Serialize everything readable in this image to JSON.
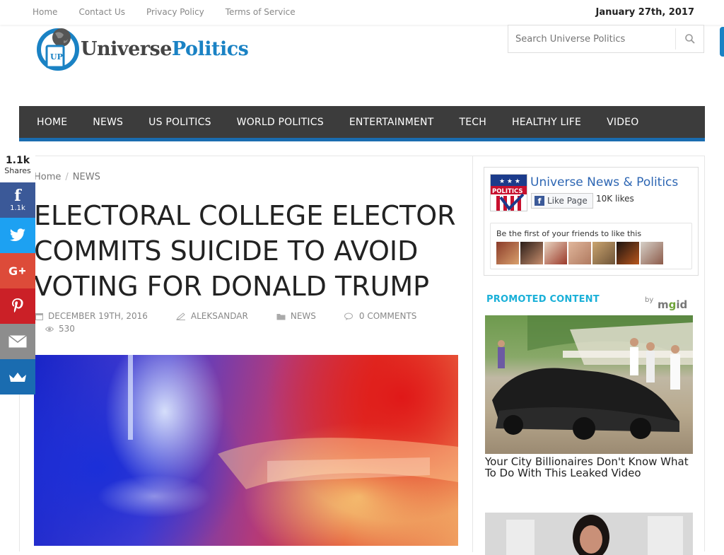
{
  "topbar": {
    "links": [
      "Home",
      "Contact Us",
      "Privacy Policy",
      "Terms of Service"
    ],
    "date": "January 27th, 2017"
  },
  "logo": {
    "mark_text": "UP",
    "name_part1": "Universe",
    "name_part2": "Politics"
  },
  "search": {
    "placeholder": "Search Universe Politics"
  },
  "nav": [
    "HOME",
    "NEWS",
    "US POLITICS",
    "WORLD POLITICS",
    "ENTERTAINMENT",
    "TECH",
    "HEALTHY LIFE",
    "VIDEO"
  ],
  "breadcrumb": {
    "home": "Home",
    "separator": "/",
    "current": "NEWS"
  },
  "article": {
    "title": "ELECTORAL COLLEGE ELECTOR COMMITS SUICIDE TO AVOID VOTING FOR DONALD TRUMP",
    "date": "DECEMBER 19TH, 2016",
    "author": "ALEKSANDAR",
    "category": "NEWS",
    "comments": "0 COMMENTS",
    "views": "530"
  },
  "share": {
    "total": "1.1k",
    "total_label": "Shares",
    "facebook_count": "1.1k",
    "facebook_glyph": "f"
  },
  "facebook_widget": {
    "page_name": "Universe News & Politics",
    "avatar_text": "POLITICS",
    "like_button": "Like Page",
    "likes": "10K likes",
    "friends_text": "Be the first of your friends to like this"
  },
  "promoted": {
    "label": "PROMOTED CONTENT",
    "by": "by",
    "brand_prefix": "m",
    "brand_g": "g",
    "brand_suffix": "id",
    "ad1_title": "Your City Billionaires Don't Know What To Do With This Leaked Video"
  },
  "colors": {
    "accent": "#1a82c4",
    "nav_bg": "#3c3c3c",
    "nav_border": "#1a6cb0",
    "facebook": "#3b5998",
    "twitter": "#1da1f2",
    "google_plus": "#dd4b39",
    "pinterest": "#cb2027",
    "email": "#8d8d8d",
    "sumo": "#1a6cb0"
  }
}
